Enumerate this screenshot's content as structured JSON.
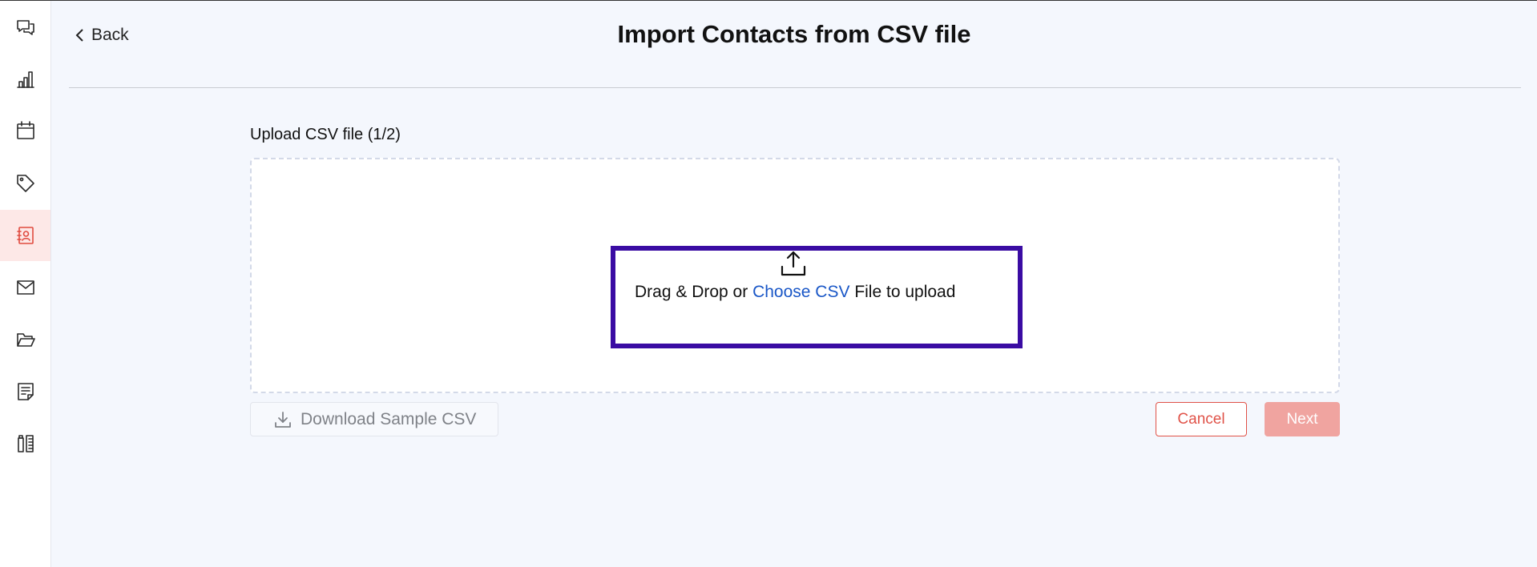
{
  "sidebar": {
    "items": [
      {
        "icon": "chat-icon",
        "active": false
      },
      {
        "icon": "chart-icon",
        "active": false
      },
      {
        "icon": "calendar-icon",
        "active": false
      },
      {
        "icon": "tag-icon",
        "active": false
      },
      {
        "icon": "contacts-icon",
        "active": true
      },
      {
        "icon": "mail-icon",
        "active": false
      },
      {
        "icon": "folder-icon",
        "active": false
      },
      {
        "icon": "notes-icon",
        "active": false
      },
      {
        "icon": "tools-icon",
        "active": false
      }
    ]
  },
  "header": {
    "back_label": "Back",
    "title": "Import Contacts from CSV file"
  },
  "upload": {
    "step_label": "Upload CSV file (1/2)",
    "drop_prefix": "Drag & Drop or",
    "choose_link": "Choose CSV",
    "drop_suffix": "File to upload"
  },
  "actions": {
    "download_sample": "Download Sample CSV",
    "cancel": "Cancel",
    "next": "Next"
  },
  "colors": {
    "accent": "#e05248",
    "link": "#1a57c7",
    "highlight": "#3a0ca3",
    "background": "#f4f7fd"
  }
}
